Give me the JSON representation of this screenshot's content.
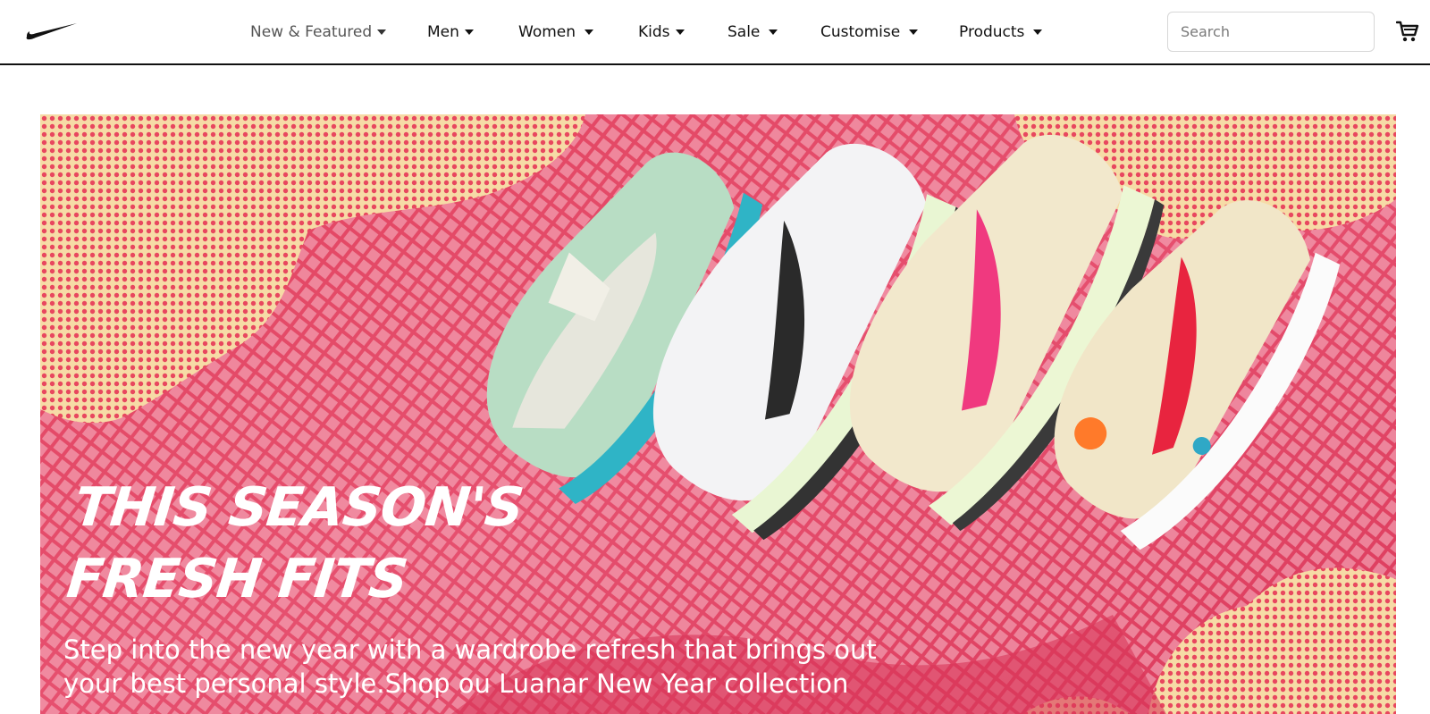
{
  "brand": {
    "logo_icon": "swoosh-logo-icon"
  },
  "nav": {
    "items": [
      {
        "label": "New & Featured"
      },
      {
        "label": "Men"
      },
      {
        "label": "Women"
      },
      {
        "label": "Kids"
      },
      {
        "label": "Sale"
      },
      {
        "label": "Customise"
      },
      {
        "label": "Products"
      }
    ],
    "search_placeholder": "Search",
    "cart_icon": "cart-icon"
  },
  "hero": {
    "title": "THIS SEASON'S\nFRESH FITS",
    "text": "Step into the new year with a wardrobe refresh that brings out your best personal style.Shop ou Luanar New Year collection",
    "colors": {
      "background": "#e4466b",
      "pattern": "#fbeeb0",
      "accent_pink": "#f0397f",
      "accent_red": "#e8243f"
    }
  }
}
